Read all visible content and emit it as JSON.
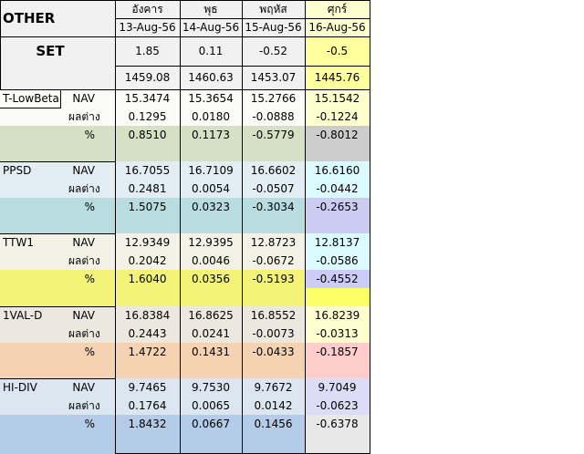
{
  "sheet": {
    "title": "OTHER",
    "index_label": "SET",
    "days": [
      "อังคาร",
      "พุธ",
      "พฤหัส",
      "ศุกร์"
    ],
    "dates": [
      "13-Aug-56",
      "14-Aug-56",
      "15-Aug-56",
      "16-Aug-56"
    ],
    "set_change": [
      "1.85",
      "0.11",
      "-0.52",
      "-0.5"
    ],
    "set_index": [
      "1459.08",
      "1460.63",
      "1453.07",
      "1445.76"
    ],
    "row_labels": [
      "NAV",
      "ผลต่าง",
      "%"
    ],
    "funds": [
      {
        "name": "T-LowBeta",
        "nav": [
          "15.3474",
          "15.3654",
          "15.2766",
          "15.1542"
        ],
        "diff": [
          "0.1295",
          "0.0180",
          "-0.0888",
          "-0.1224"
        ],
        "pct": [
          "0.8510",
          "0.1173",
          "-0.5779",
          "-0.8012"
        ]
      },
      {
        "name": "PPSD",
        "nav": [
          "16.7055",
          "16.7109",
          "16.6602",
          "16.6160"
        ],
        "diff": [
          "0.2481",
          "0.0054",
          "-0.0507",
          "-0.0442"
        ],
        "pct": [
          "1.5075",
          "0.0323",
          "-0.3034",
          "-0.2653"
        ]
      },
      {
        "name": "TTW1",
        "nav": [
          "12.9349",
          "12.9395",
          "12.8723",
          "12.8137"
        ],
        "diff": [
          "0.2042",
          "0.0046",
          "-0.0672",
          "-0.0586"
        ],
        "pct": [
          "1.6040",
          "0.0356",
          "-0.5193",
          "-0.4552"
        ]
      },
      {
        "name": "1VAL-D",
        "nav": [
          "16.8384",
          "16.8625",
          "16.8552",
          "16.8239"
        ],
        "diff": [
          "0.2443",
          "0.0241",
          "-0.0073",
          "-0.0313"
        ],
        "pct": [
          "1.4722",
          "0.1431",
          "-0.0433",
          "-0.1857"
        ]
      },
      {
        "name": "HI-DIV",
        "nav": [
          "9.7465",
          "9.7530",
          "9.7672",
          "9.7049"
        ],
        "diff": [
          "0.1764",
          "0.0065",
          "0.0142",
          "-0.0623"
        ],
        "pct": [
          "1.8432",
          "0.0667",
          "0.1456",
          "-0.6378"
        ]
      }
    ]
  },
  "colors": {
    "header_bg": "#f1f1f1",
    "friday_header": "#ffffd0",
    "friday_set": "#ffff9e",
    "fund_bands": [
      {
        "top": "#fbfbf8",
        "bottom": "#d5e0c4",
        "friday": "#ffffd0",
        "friday_pct": "#cccccc"
      },
      {
        "top": "#e3eef4",
        "bottom": "#b8dce0",
        "friday": "#dcfbff",
        "friday_pct": "#ccccf2"
      },
      {
        "top": "#f2f2e6",
        "bottom": "#f3f477",
        "friday": "#dcfbff",
        "friday_pct": "#ccccf8",
        "friday_low": "#ffff66"
      },
      {
        "top": "#ece8e0",
        "bottom": "#f5d3b2",
        "friday": "#ffffd0",
        "friday_pct": "#ffcccc"
      },
      {
        "top": "#dce6f0",
        "bottom": "#b4cce8",
        "friday": "#dcdcf6",
        "friday_pct": "#e8e8e8"
      }
    ]
  }
}
